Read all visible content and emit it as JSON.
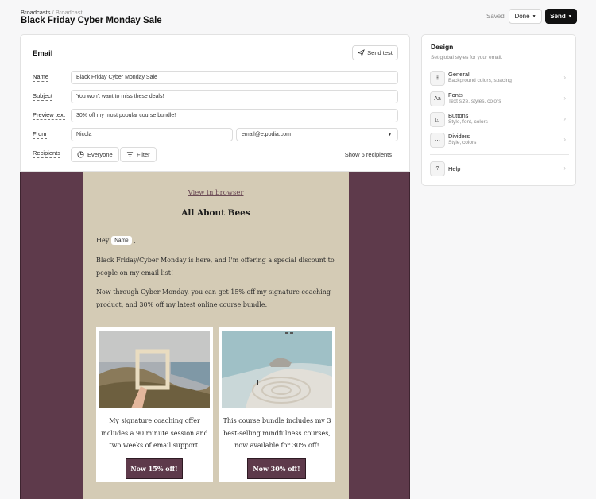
{
  "breadcrumb": {
    "parent": "Broadcasts",
    "separator": "/",
    "current": "Broadcast"
  },
  "page_title": "Black Friday Cyber Monday Sale",
  "header": {
    "status": "Saved",
    "done_label": "Done",
    "send_label": "Send"
  },
  "email_card": {
    "title": "Email",
    "send_test_label": "Send test",
    "labels": {
      "name": "Name",
      "subject": "Subject",
      "preview": "Preview text",
      "from": "From",
      "recipients": "Recipients"
    },
    "values": {
      "name": "Black Friday Cyber Monday Sale",
      "subject": "You won't want to miss these deals!",
      "preview": "30% off my most popular course bundle!",
      "from_name": "Nicola",
      "from_email": "email@e.podia.com"
    },
    "recipients": {
      "everyone": "Everyone",
      "filter": "Filter",
      "show": "Show 6 recipients"
    }
  },
  "email_preview": {
    "view_link": "View in browser",
    "title": "All About Bees",
    "greeting": "Hey",
    "name_tag": "Name",
    "greeting_end": ",",
    "paragraph1": "Black Friday/Cyber Monday is here, and I'm offering a special discount to people on my email list!",
    "paragraph2": "Now through Cyber Monday, you can get 15% off my signature coaching product, and 30% off my latest online course bundle.",
    "products": [
      {
        "text": "My signature coaching offer includes a 90 minute session and two weeks of email support.",
        "button": "Now 15% off!"
      },
      {
        "text": "This course bundle includes my 3 best-selling mindfulness courses, now available for 30% off!",
        "button": "Now 30% off!"
      }
    ]
  },
  "design_panel": {
    "title": "Design",
    "subtitle": "Set global styles for your email.",
    "items": [
      {
        "name": "General",
        "desc": "Background colors, spacing",
        "icon": "sliders-icon"
      },
      {
        "name": "Fonts",
        "desc": "Text size, styles, colors",
        "icon": "font-icon"
      },
      {
        "name": "Buttons",
        "desc": "Style, font, colors",
        "icon": "button-icon"
      },
      {
        "name": "Dividers",
        "desc": "Style, colors",
        "icon": "divider-icon"
      }
    ],
    "help": {
      "name": "Help",
      "icon": "help-icon"
    }
  },
  "colors": {
    "brand_plum": "#5e3a4b",
    "email_bg": "#d4cbb5",
    "send_button": "#111111"
  }
}
